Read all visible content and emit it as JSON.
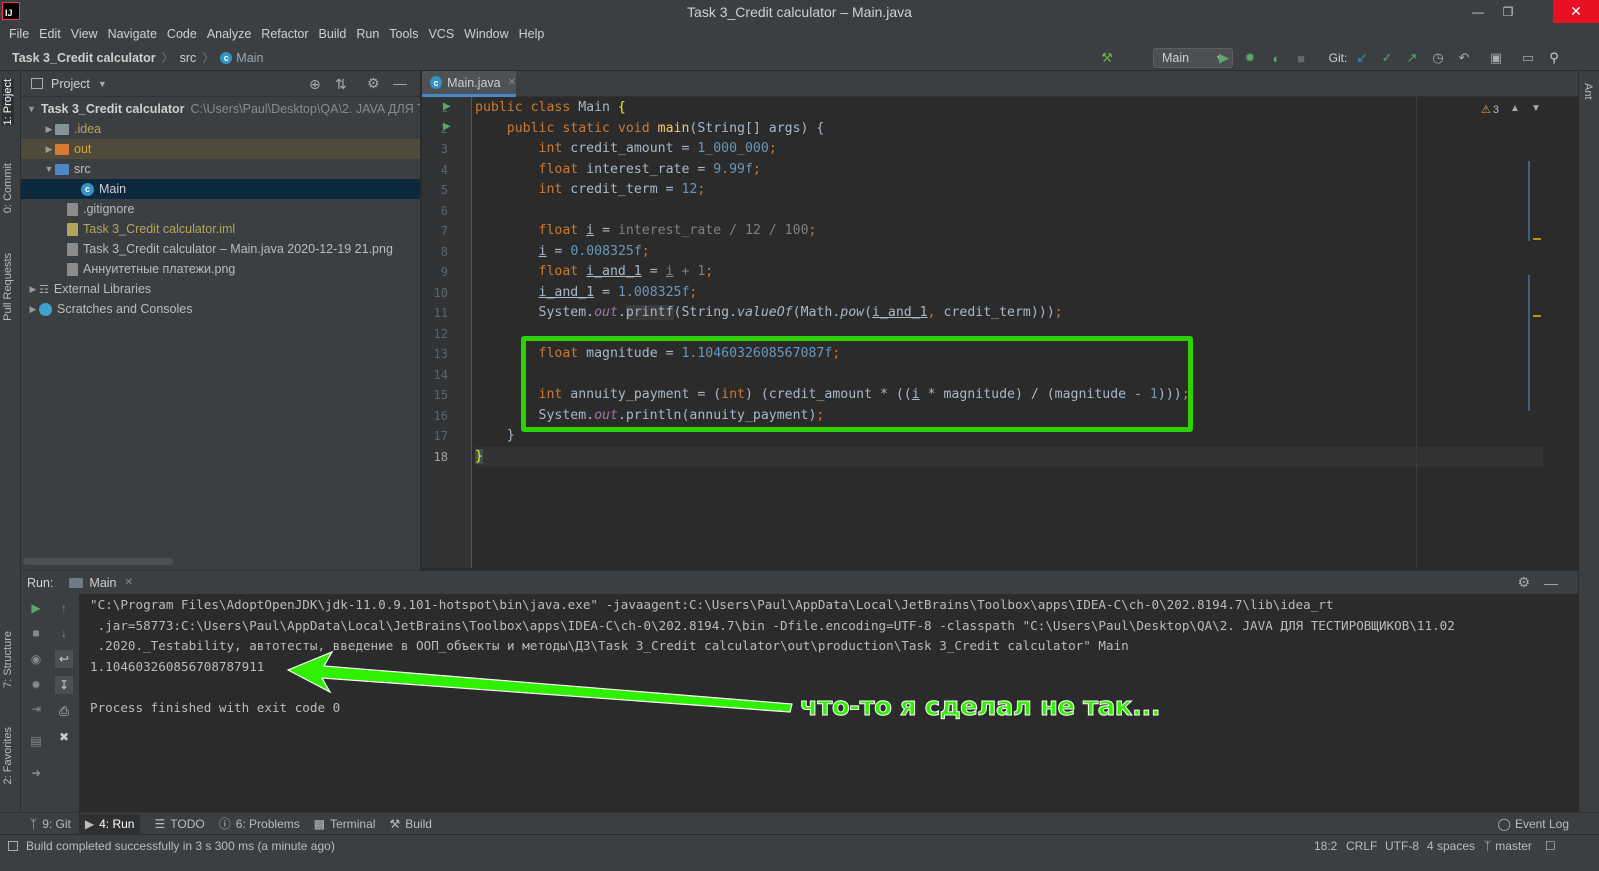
{
  "window": {
    "title": "Task 3_Credit calculator – Main.java",
    "logo": "IJ"
  },
  "menu": [
    "File",
    "Edit",
    "View",
    "Navigate",
    "Code",
    "Analyze",
    "Refactor",
    "Build",
    "Run",
    "Tools",
    "VCS",
    "Window",
    "Help"
  ],
  "breadcrumb": [
    "Task 3_Credit calculator",
    "src",
    "Main"
  ],
  "toolbar": {
    "run_config": "Main",
    "git_label": "Git:"
  },
  "left_tabs": [
    "1: Project",
    "0: Commit",
    "Pull Requests",
    "7: Structure",
    "2: Favorites"
  ],
  "right_tabs": [
    "Ant"
  ],
  "project": {
    "header": "Project",
    "rows": [
      {
        "label": "Task 3_Credit calculator",
        "path": "C:\\Users\\Paul\\Desktop\\QA\\2. JAVA ДЛЯ ТЕСТ"
      },
      {
        "label": ".idea"
      },
      {
        "label": "out"
      },
      {
        "label": "src"
      },
      {
        "label": "Main"
      },
      {
        "label": ".gitignore"
      },
      {
        "label": "Task 3_Credit calculator.iml"
      },
      {
        "label": "Task 3_Credit calculator – Main.java 2020-12-19 21.png"
      },
      {
        "label": "Аннуитетные платежи.png"
      },
      {
        "label": "External Libraries"
      },
      {
        "label": "Scratches and Consoles"
      }
    ]
  },
  "editor": {
    "tab": "Main.java",
    "warnings": "3",
    "line_numbers": [
      "1",
      "2",
      "3",
      "4",
      "5",
      "6",
      "7",
      "8",
      "9",
      "10",
      "11",
      "12",
      "13",
      "14",
      "15",
      "16",
      "17",
      "18"
    ]
  },
  "run_panel": {
    "label": "Run:",
    "tab": "Main",
    "console": [
      "\"C:\\Program Files\\AdoptOpenJDK\\jdk-11.0.9.101-hotspot\\bin\\java.exe\" -javaagent:C:\\Users\\Paul\\AppData\\Local\\JetBrains\\Toolbox\\apps\\IDEA-C\\ch-0\\202.8194.7\\lib\\idea_rt",
      " .jar=58773:C:\\Users\\Paul\\AppData\\Local\\JetBrains\\Toolbox\\apps\\IDEA-C\\ch-0\\202.8194.7\\bin -Dfile.encoding=UTF-8 -classpath \"C:\\Users\\Paul\\Desktop\\QA\\2. JAVA ДЛЯ ТЕСТИРОВЩИКОВ\\11.02",
      " .2020._Testability, автотесты, введение в ООП_объекты и методы\\ДЗ\\Task 3_Credit calculator\\out\\production\\Task 3_Credit calculator\" Main",
      "1.104603260856708787911",
      "",
      "Process finished with exit code 0"
    ],
    "annotation": "что-то я сделал не так..."
  },
  "bottom_tabs": [
    "9: Git",
    "4: Run",
    "TODO",
    "6: Problems",
    "Terminal",
    "Build"
  ],
  "event_log": "Event Log",
  "status": {
    "message": "Build completed successfully in 3 s 300 ms (a minute ago)",
    "position": "18:2",
    "line_sep": "CRLF",
    "encoding": "UTF-8",
    "indent": "4 spaces",
    "branch": "master"
  },
  "colors": {
    "accent_green": "#2ed000",
    "keyword": "#cc7832",
    "number": "#6897bb",
    "field": "#9876aa"
  }
}
